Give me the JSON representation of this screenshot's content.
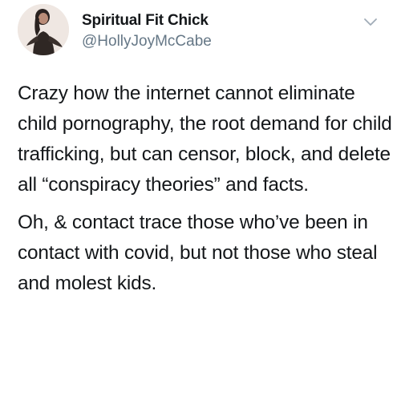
{
  "tweet": {
    "display_name": "Spiritual Fit Chick",
    "handle": "@HollyJoyMcCabe",
    "avatar_icon": "profile-photo",
    "menu_icon": "chevron-down-icon",
    "paragraphs": [
      "Crazy how the internet cannot eliminate child pornography, the root demand for child trafficking, but can censor, block, and delete all “conspiracy theories” and facts.",
      "Oh, & contact trace those who’ve been in contact with covid, but not those who steal and molest kids."
    ]
  },
  "colors": {
    "text": "#14171a",
    "secondary_text": "#657786",
    "background": "#ffffff",
    "chevron": "#a0acb7"
  }
}
